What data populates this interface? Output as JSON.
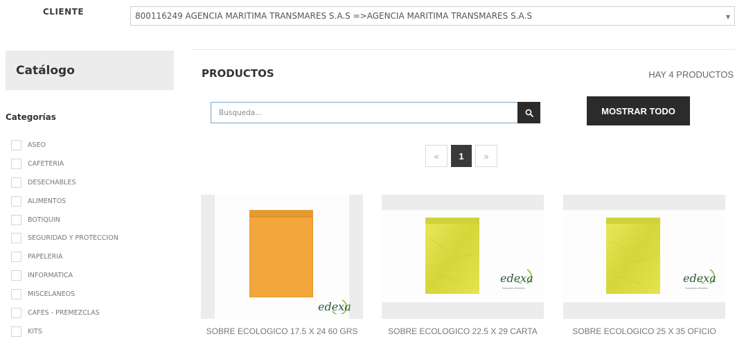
{
  "client": {
    "label": "CLIENTE",
    "selected": "800116249 AGENCIA MARITIMA TRANSMARES S.A.S =>AGENCIA MARITIMA TRANSMARES S.A.S"
  },
  "sidebar": {
    "title": "Catálogo",
    "categories_title": "Categorías",
    "categories": [
      {
        "label": "ASEO"
      },
      {
        "label": "CAFETERIA"
      },
      {
        "label": "DESECHABLES"
      },
      {
        "label": "ALIMENTOS"
      },
      {
        "label": "BOTIQUIN"
      },
      {
        "label": "SEGURIDAD Y PROTECCION"
      },
      {
        "label": "PAPELERIA"
      },
      {
        "label": "INFORMATICA"
      },
      {
        "label": "MISCELANEOS"
      },
      {
        "label": "CAFES - PREMEZCLAS"
      },
      {
        "label": "KITS"
      }
    ]
  },
  "main": {
    "title": "PRODUCTOS",
    "count_text": "HAY 4 PRODUCTOS",
    "search": {
      "placeholder": "Busqueda...",
      "value": "",
      "button_icon": "search-icon"
    },
    "show_all_label": "MOSTRAR TODO",
    "pagination": {
      "prev": "«",
      "current": "1",
      "next": "»"
    },
    "products": [
      {
        "name": "SOBRE ECOLOGICO 17.5 X 24 60 GRS",
        "envelope_color": "#f2a63c",
        "logo_text": "edexa"
      },
      {
        "name": "SOBRE ECOLOGICO 22.5 X 29 CARTA",
        "envelope_color": "#dede3e",
        "logo_text": "edexa",
        "logo_sub": "Soluciones eficientes"
      },
      {
        "name": "SOBRE ECOLOGICO 25 X 35 OFICIO",
        "envelope_color": "#dede3e",
        "logo_text": "edexa",
        "logo_sub": "Soluciones eficientes"
      }
    ]
  },
  "colors": {
    "dark_button": "#2b2b2b",
    "sidebar_box": "#ececec",
    "search_border": "#7fb0d6",
    "logo_green": "#2a5a3a"
  }
}
